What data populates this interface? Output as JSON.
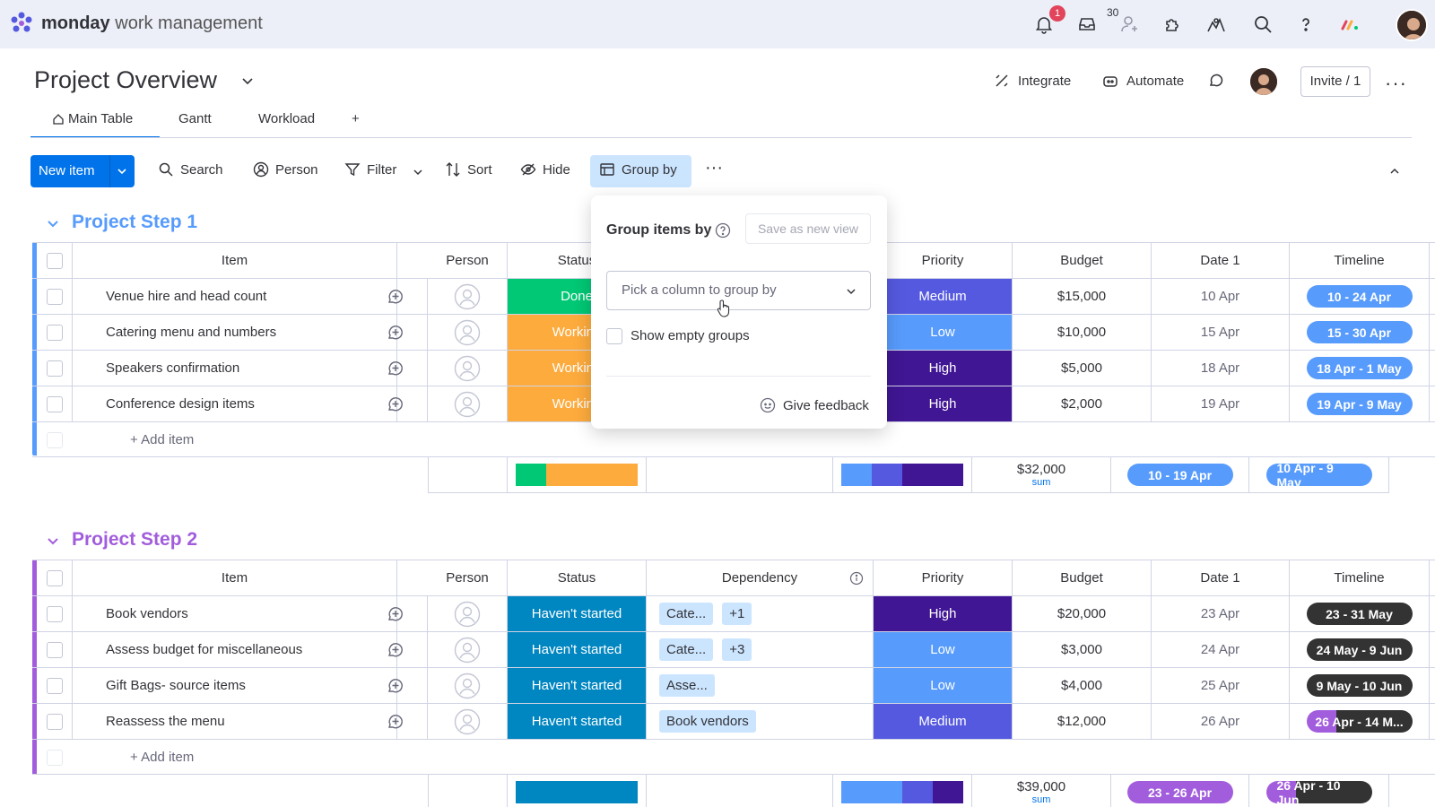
{
  "app": {
    "brand_bold": "monday",
    "brand_light": "work management"
  },
  "topbar": {
    "notifications_count": "1",
    "inbox_count": "30"
  },
  "header": {
    "title": "Project Overview",
    "integrate": "Integrate",
    "automate": "Automate",
    "invite": "Invite / 1"
  },
  "tabs": [
    {
      "label": "Main Table"
    },
    {
      "label": "Gantt"
    },
    {
      "label": "Workload"
    },
    {
      "label": "+"
    }
  ],
  "toolbar": {
    "new_item": "New item",
    "search": "Search",
    "person": "Person",
    "filter": "Filter",
    "sort": "Sort",
    "hide": "Hide",
    "group_by": "Group by"
  },
  "popover": {
    "title": "Group items by",
    "save_view": "Save as new view",
    "select_placeholder": "Pick a column to group by",
    "show_empty": "Show empty groups",
    "feedback": "Give feedback"
  },
  "colors": {
    "done": "#00c875",
    "working": "#fdab3d",
    "not_started": "#0086c0",
    "high": "#401694",
    "medium": "#5559df",
    "low": "#579bfc",
    "timeline_blue": "#579bfc",
    "timeline_dark": "#333333",
    "timeline_purple": "#a25ddc",
    "group1": "#579bfc",
    "group2": "#a25ddc"
  },
  "group1": {
    "title": "Project Step 1",
    "columns": {
      "item": "Item",
      "person": "Person",
      "status": "Status",
      "priority": "Priority",
      "budget": "Budget",
      "date": "Date 1",
      "timeline": "Timeline"
    },
    "rows": [
      {
        "item": "Venue hire and head count",
        "status": "Done",
        "priority": "Medium",
        "budget": "$15,000",
        "date": "10 Apr",
        "timeline": "10 - 24 Apr"
      },
      {
        "item": "Catering menu and numbers",
        "status": "Working",
        "priority": "Low",
        "budget": "$10,000",
        "date": "15 Apr",
        "timeline": "15 - 30 Apr"
      },
      {
        "item": "Speakers confirmation",
        "status": "Working",
        "priority": "High",
        "budget": "$5,000",
        "date": "18 Apr",
        "timeline": "18 Apr - 1 May"
      },
      {
        "item": "Conference design items",
        "status": "Working",
        "priority": "High",
        "budget": "$2,000",
        "date": "19 Apr",
        "timeline": "19 Apr - 9 May"
      }
    ],
    "add_item": "+ Add item",
    "summary": {
      "budget": "$32,000",
      "budget_label": "sum",
      "date": "10 - 19 Apr",
      "timeline": "10 Apr - 9 May"
    }
  },
  "group2": {
    "title": "Project Step 2",
    "columns": {
      "item": "Item",
      "person": "Person",
      "status": "Status",
      "dependency": "Dependency",
      "priority": "Priority",
      "budget": "Budget",
      "date": "Date 1",
      "timeline": "Timeline"
    },
    "rows": [
      {
        "item": "Book vendors",
        "status": "Haven't started",
        "dep": "Cate...",
        "dep_more": "+1",
        "priority": "High",
        "budget": "$20,000",
        "date": "23 Apr",
        "timeline": "23 - 31 May"
      },
      {
        "item": "Assess budget for miscellaneous",
        "status": "Haven't started",
        "dep": "Cate...",
        "dep_more": "+3",
        "priority": "Low",
        "budget": "$3,000",
        "date": "24 Apr",
        "timeline": "24 May - 9 Jun"
      },
      {
        "item": "Gift Bags- source items",
        "status": "Haven't started",
        "dep": "Asse...",
        "dep_more": "",
        "priority": "Low",
        "budget": "$4,000",
        "date": "25 Apr",
        "timeline": "9 May - 10 Jun"
      },
      {
        "item": "Reassess the menu",
        "status": "Haven't started",
        "dep": "Book vendors",
        "dep_more": "",
        "priority": "Medium",
        "budget": "$12,000",
        "date": "26 Apr",
        "timeline": "26 Apr - 14 M..."
      }
    ],
    "add_item": "+ Add item",
    "summary": {
      "budget": "$39,000",
      "budget_label": "sum",
      "date": "23 - 26 Apr",
      "timeline": "26 Apr - 10 Jun"
    }
  }
}
